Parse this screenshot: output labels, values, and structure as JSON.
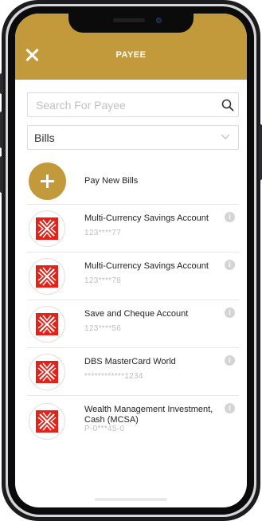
{
  "header": {
    "title": "PAYEE"
  },
  "search": {
    "placeholder": "Search For Payee"
  },
  "filter": {
    "selected": "Bills"
  },
  "pay_new": {
    "label": "Pay New Bills"
  },
  "payees": [
    {
      "name": "Multi-Currency Savings Account",
      "account": "123****77"
    },
    {
      "name": "Multi-Currency Savings Account",
      "account": "123****78"
    },
    {
      "name": "Save and Cheque Account",
      "account": "123****56"
    },
    {
      "name": "DBS MasterCard World",
      "account": "************1234"
    },
    {
      "name": "Wealth Management Investment, Cash (MCSA)",
      "account": "P-0***45-0"
    }
  ],
  "colors": {
    "brand_gold": "#c29a3c",
    "dbs_red": "#e2231a"
  },
  "icons": {
    "close": "close-icon",
    "search": "search-icon",
    "dropdown": "chevron-down-icon",
    "add": "plus-icon",
    "payee_logo": "dbs-logo-icon",
    "info": "info-icon"
  }
}
